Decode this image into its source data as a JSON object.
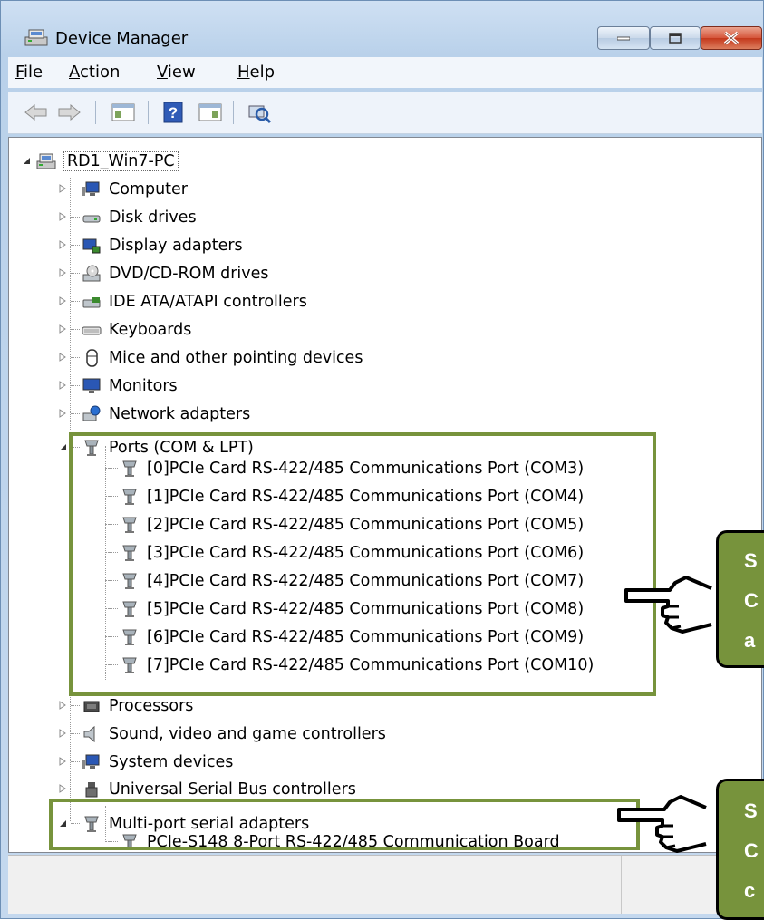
{
  "window": {
    "title": "Device Manager"
  },
  "menu": [
    {
      "label": "File",
      "accel": "F",
      "rest": "ile"
    },
    {
      "label": "Action",
      "accel": "A",
      "rest": "ction"
    },
    {
      "label": "View",
      "accel": "V",
      "rest": "iew"
    },
    {
      "label": "Help",
      "accel": "H",
      "rest": "elp"
    }
  ],
  "toolbar": {
    "buttons": [
      "back-icon",
      "forward-icon",
      "show-hide-console-tree-icon",
      "help-icon",
      "properties-icon",
      "scan-hardware-icon"
    ]
  },
  "tree": {
    "root": "RD1_Win7-PC",
    "categories": [
      {
        "label": "Computer",
        "icon": "computer-icon",
        "expanded": false
      },
      {
        "label": "Disk drives",
        "icon": "disk-drive-icon",
        "expanded": false
      },
      {
        "label": "Display adapters",
        "icon": "display-adapter-icon",
        "expanded": false
      },
      {
        "label": "DVD/CD-ROM drives",
        "icon": "dvd-drive-icon",
        "expanded": false
      },
      {
        "label": "IDE ATA/ATAPI controllers",
        "icon": "ide-controller-icon",
        "expanded": false
      },
      {
        "label": "Keyboards",
        "icon": "keyboard-icon",
        "expanded": false
      },
      {
        "label": "Mice and other pointing devices",
        "icon": "mouse-icon",
        "expanded": false
      },
      {
        "label": "Monitors",
        "icon": "monitor-icon",
        "expanded": false
      },
      {
        "label": "Network adapters",
        "icon": "network-adapter-icon",
        "expanded": false
      },
      {
        "label": "Ports (COM & LPT)",
        "icon": "port-icon",
        "expanded": true
      },
      {
        "label": "Processors",
        "icon": "processor-icon",
        "expanded": false
      },
      {
        "label": "Sound, video and game controllers",
        "icon": "sound-icon",
        "expanded": false
      },
      {
        "label": "System devices",
        "icon": "system-device-icon",
        "expanded": false
      },
      {
        "label": "Universal Serial Bus controllers",
        "icon": "usb-icon",
        "expanded": false
      },
      {
        "label": "Multi-port serial adapters",
        "icon": "port-icon",
        "expanded": true
      }
    ],
    "ports": [
      "[0]PCIe Card RS-422/485 Communications Port (COM3)",
      "[1]PCIe Card RS-422/485 Communications Port (COM4)",
      "[2]PCIe Card RS-422/485 Communications Port (COM5)",
      "[3]PCIe Card RS-422/485 Communications Port (COM6)",
      "[4]PCIe Card RS-422/485 Communications Port (COM7)",
      "[5]PCIe Card RS-422/485 Communications Port (COM8)",
      "[6]PCIe Card RS-422/485 Communications Port (COM9)",
      "[7]PCIe Card RS-422/485 Communications Port (COM10)"
    ],
    "adapters": [
      "PCIe-S148 8-Port RS-422/485 Communication Board"
    ]
  },
  "callouts": [
    {
      "lines": [
        "S",
        "C",
        "a"
      ]
    },
    {
      "lines": [
        "S",
        "C",
        "c"
      ]
    }
  ],
  "colors": {
    "highlight": "#77933c"
  }
}
